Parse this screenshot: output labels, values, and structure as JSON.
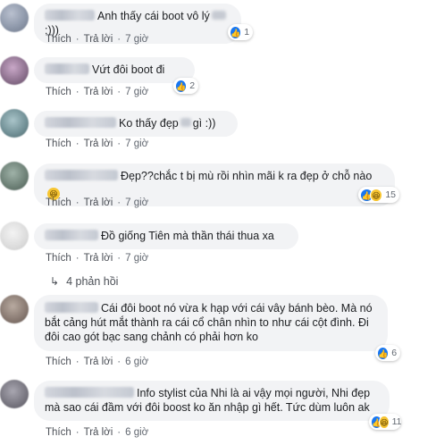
{
  "comments": [
    {
      "text": "Anh thấy cái boot vô lý :)))",
      "text_a": "Anh thấy cái boot vô lý",
      "text_b": ":)))",
      "like": "Thích",
      "reply": "Trả lời",
      "time": "7 giờ",
      "count": "1"
    },
    {
      "text": "Vứt đôi boot đi",
      "like": "Thích",
      "reply": "Trả lời",
      "time": "7 giờ",
      "count": "2"
    },
    {
      "text_a": "Ko thấy đẹp",
      "text_b": "gì :))",
      "like": "Thích",
      "reply": "Trả lời",
      "time": "7 giờ"
    },
    {
      "text": "Đẹp??chắc t bị mù rồi nhìn mãi k ra đẹp ở chỗ nào",
      "like": "Thích",
      "reply": "Trả lời",
      "time": "7 giờ",
      "count": "15"
    },
    {
      "text": "Đồ giống Tiên mà thần thái thua xa",
      "like": "Thích",
      "reply": "Trả lời",
      "time": "7 giờ"
    },
    {
      "text": "Cái đôi boot nó vừa k hạp với cái vây bánh bèo. Mà nó bắt cảng hút mắt thành ra cái cổ chân nhìn to như cái cột đình. Đi đôi cao gót bạc sang chảnh có phải hơn ko",
      "like": "Thích",
      "reply": "Trả lời",
      "time": "6 giờ",
      "count": "6"
    },
    {
      "text": "Info stylist của Nhi là ai vậy mọi người, Nhi đẹp mà sao cái đầm với đôi boost ko ăn nhập gì hết. Tức dùm luôn ak",
      "like": "Thích",
      "reply": "Trả lời",
      "time": "6 giờ",
      "count": "11"
    }
  ],
  "replies_link": "4 phản hồi",
  "icons": {
    "like": "like-icon",
    "haha": "haha-icon",
    "reply_arrow": "reply-arrow-icon",
    "laugh_emoji": "laughing-emoji-icon"
  },
  "colors": {
    "bubble": "#f2f3f5",
    "like_blue": "#1877f2",
    "meta_text": "#616770"
  }
}
